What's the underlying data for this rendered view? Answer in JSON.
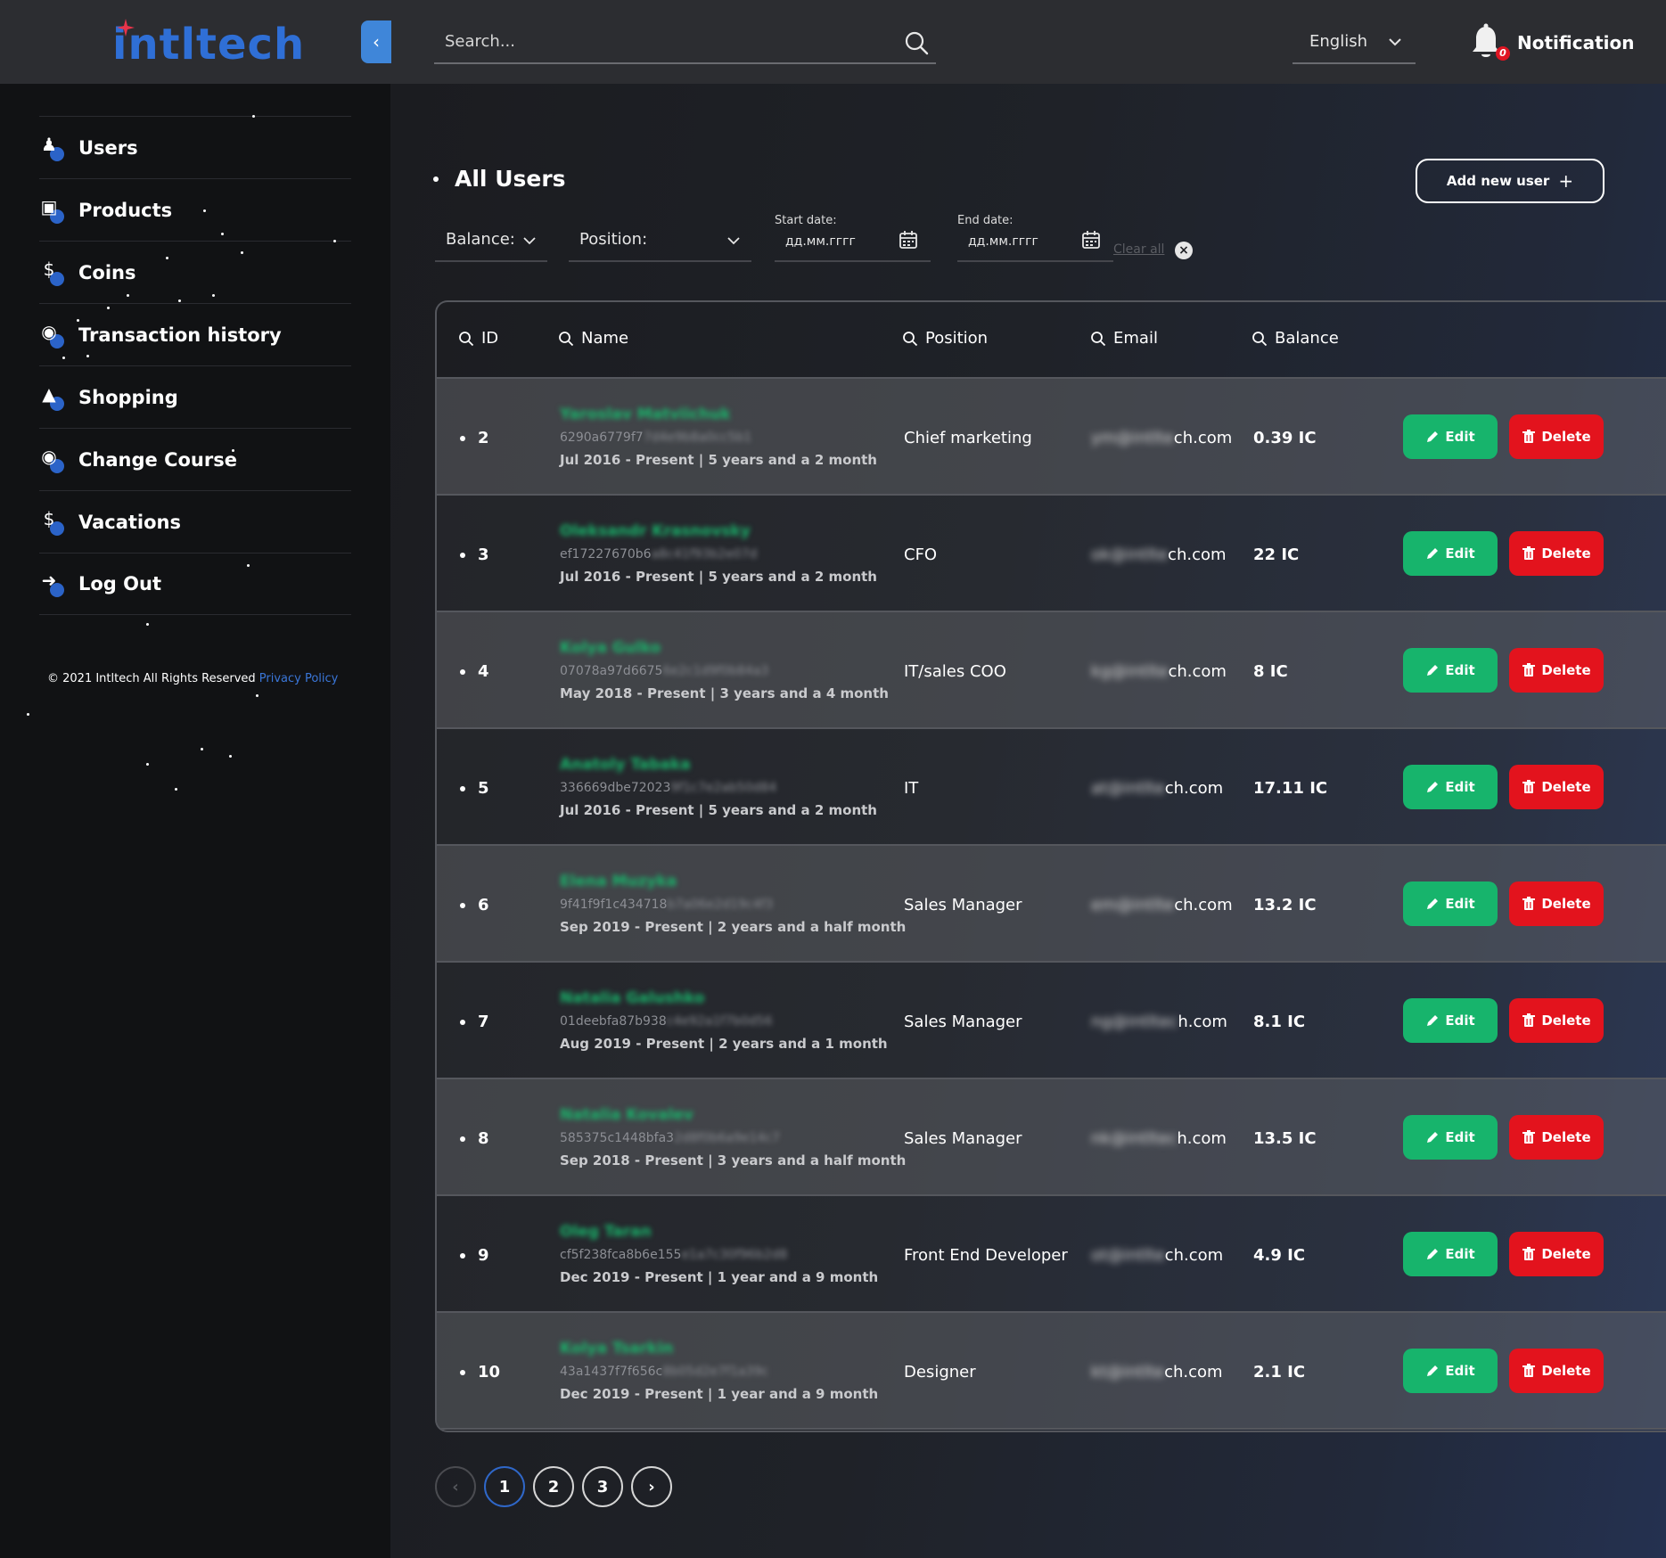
{
  "brand": {
    "name": "intltech"
  },
  "header": {
    "search_placeholder": "Search...",
    "language": "English",
    "notification_label": "Notification",
    "notification_count": "0"
  },
  "sidebar": {
    "items": [
      {
        "label": "Users",
        "icon": "user-icon"
      },
      {
        "label": "Products",
        "icon": "box-icon"
      },
      {
        "label": "Coins",
        "icon": "coin-icon"
      },
      {
        "label": "Transaction history",
        "icon": "transaction-icon"
      },
      {
        "label": "Shopping",
        "icon": "shopping-bag-icon"
      },
      {
        "label": "Change Course",
        "icon": "exchange-icon"
      },
      {
        "label": "Vacations",
        "icon": "vacation-icon"
      },
      {
        "label": "Log Out",
        "icon": "logout-icon"
      }
    ],
    "copyright": "© 2021 Intltech All Rights Reserved",
    "privacy_link": "Privacy Policy"
  },
  "main": {
    "title": "All Users",
    "add_button": "Add new user",
    "filters": {
      "balance_label": "Balance:",
      "position_label": "Position:",
      "start_date_label": "Start date:",
      "start_date_value": "дд.мм.гггг",
      "end_date_label": "End date:",
      "end_date_value": "дд.мм.гггг",
      "clear_all": "Clear all"
    },
    "columns": {
      "id": "ID",
      "name": "Name",
      "position": "Position",
      "email": "Email",
      "balance": "Balance"
    },
    "edit_label": "Edit",
    "delete_label": "Delete",
    "rows": [
      {
        "id": "2",
        "name": "Yaroslav Matviichuk",
        "hash_visible": "6290a6779f7",
        "hash_blurred": "7d4e9b8a0cc5b1",
        "tenure": "Jul 2016 - Present | 5 years and a 2 month",
        "position": "Chief marketing",
        "email_blurred": "ym@intlte",
        "email_visible": "ch.com",
        "balance": "0.39 IC"
      },
      {
        "id": "3",
        "name": "Oleksandr Krasnovsky",
        "hash_visible": "ef17227670b6",
        "hash_blurred": "a8c41f93b2e07d",
        "tenure": "Jul 2016 - Present | 5 years and a 2 month",
        "position": "CFO",
        "email_blurred": "ok@intlte",
        "email_visible": "ch.com",
        "balance": "22 IC"
      },
      {
        "id": "4",
        "name": "Kolya Gulko",
        "hash_visible": "07078a97d6675",
        "hash_blurred": "6e2c1d9f0b84a3",
        "tenure": "May 2018 - Present | 3 years and a 4 month",
        "position": "IT/sales COO",
        "email_blurred": "kg@intlte",
        "email_visible": "ch.com",
        "balance": "8 IC"
      },
      {
        "id": "5",
        "name": "Anatoly Tabaka",
        "hash_visible": "336669dbe72023",
        "hash_blurred": "9f1c7e2ab50d84",
        "tenure": "Jul 2016 - Present | 5 years and a 2 month",
        "position": "IT",
        "email_blurred": "at@intlte",
        "email_visible": "ch.com",
        "balance": "17.11 IC"
      },
      {
        "id": "6",
        "name": "Elena Muzyka",
        "hash_visible": "9f41f9f1c434718",
        "hash_blurred": "b7a06e2d19c4f3",
        "tenure": "Sep 2019 - Present | 2 years and a half month",
        "position": "Sales Manager",
        "email_blurred": "em@intlte",
        "email_visible": "ch.com",
        "balance": "13.2 IC"
      },
      {
        "id": "7",
        "name": "Natalia Galushko",
        "hash_visible": "01deebfa87b938",
        "hash_blurred": "c4e92a1f7b0d56",
        "tenure": "Aug 2019 - Present | 2 years and a 1 month",
        "position": "Sales Manager",
        "email_blurred": "ng@intltec",
        "email_visible": "h.com",
        "balance": "8.1 IC"
      },
      {
        "id": "8",
        "name": "Natalia Kovalev",
        "hash_visible": "585375c1448bfa3",
        "hash_blurred": "2d8f0b6a9e14c7",
        "tenure": "Sep 2018 - Present | 3 years and a half month",
        "position": "Sales Manager",
        "email_blurred": "nk@intltec",
        "email_visible": "h.com",
        "balance": "13.5 IC"
      },
      {
        "id": "9",
        "name": "Oleg Taran",
        "hash_visible": "cf5f238fca8b6e155",
        "hash_blurred": "e1a7c30f96b2d8",
        "tenure": "Dec 2019 - Present | 1 year and a 9 month",
        "position": "Front End Developer",
        "email_blurred": "ot@intlte",
        "email_visible": "ch.com",
        "balance": "4.9 IC"
      },
      {
        "id": "10",
        "name": "Kolya Tsarkin",
        "hash_visible": "43a1437f7f656c",
        "hash_blurred": "8b05d2e7f1a39c",
        "tenure": "Dec 2019 - Present | 1 year and a 9 month",
        "position": "Designer",
        "email_blurred": "kt@intlte",
        "email_visible": "ch.com",
        "balance": "2.1 IC"
      }
    ]
  },
  "pagination": {
    "prev": "‹",
    "pages": [
      "1",
      "2",
      "3"
    ],
    "next": "›",
    "current": "1"
  },
  "colors": {
    "accent": "#2f6fd6",
    "edit": "#17b46c",
    "delete": "#e3131d",
    "sidebar_bg": "#111214",
    "topbar_bg": "#2c2d31"
  }
}
